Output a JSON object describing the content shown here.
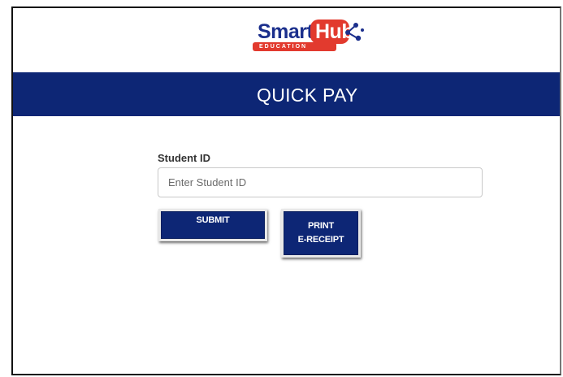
{
  "logo": {
    "brand_part1": "Smart",
    "brand_part2": "Hub",
    "tagline": "EDUCATION",
    "colors": {
      "navy": "#1b2f8c",
      "red": "#e23a2e"
    }
  },
  "header": {
    "title": "QUICK PAY",
    "background": "#0d2675"
  },
  "form": {
    "student_id_label": "Student ID",
    "student_id_placeholder": "Enter Student ID",
    "student_id_value": "",
    "submit_label": "SUBMIT",
    "print_label": "PRINT\nE-RECEIPT"
  }
}
